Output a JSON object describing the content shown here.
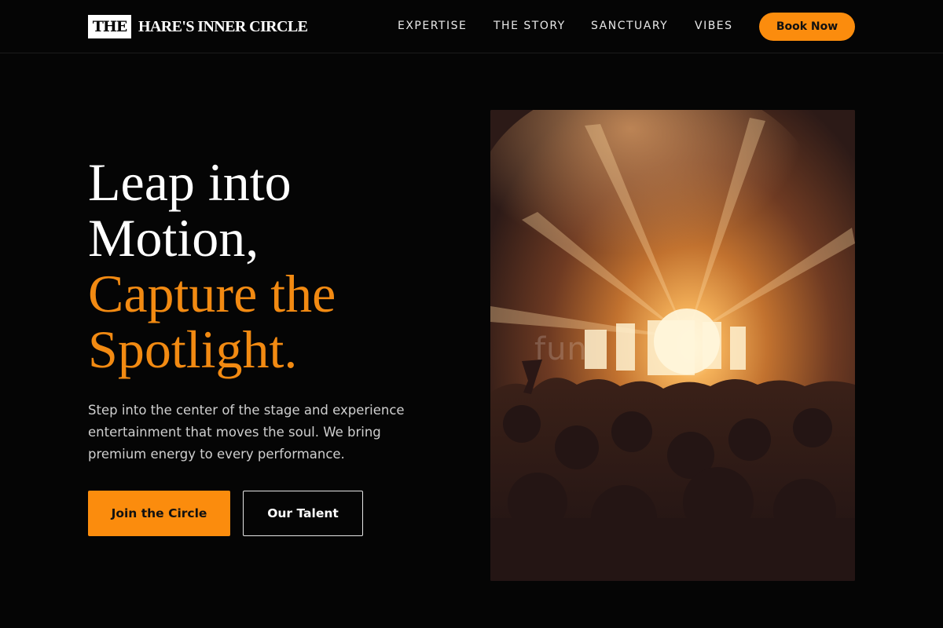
{
  "brand": {
    "badge": "THE",
    "name": "HARE'S INNER CIRCLE"
  },
  "nav": {
    "items": [
      {
        "label": "EXPERTISE"
      },
      {
        "label": "THE STORY"
      },
      {
        "label": "SANCTUARY"
      },
      {
        "label": "VIBES"
      }
    ],
    "cta_label": "Book Now"
  },
  "hero": {
    "headline_white_1": "Leap into",
    "headline_white_2": "Motion,",
    "headline_orange_1": "Capture the",
    "headline_orange_2": "Spotlight.",
    "description": "Step into the center of the stage and experience entertainment that moves the soul. We bring premium energy to every performance.",
    "primary_button": "Join the Circle",
    "secondary_button": "Our Talent"
  },
  "image": {
    "subject": "concert crowd facing stage lights",
    "watermark": "fun"
  },
  "colors": {
    "accent": "#fb8c0d",
    "headline_accent": "#f28a12",
    "background": "#050505"
  }
}
